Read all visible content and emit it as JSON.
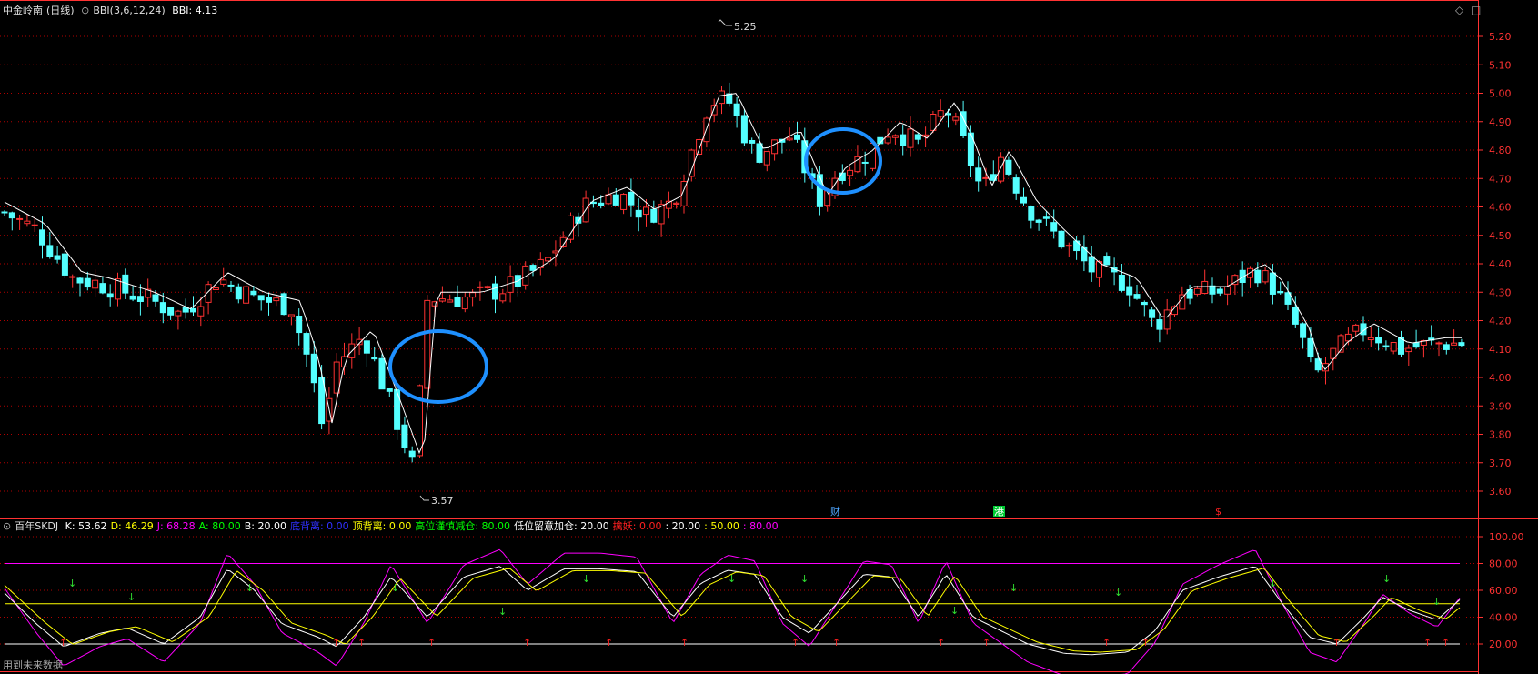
{
  "main": {
    "stock_name": "中金岭南",
    "period": "(日线)",
    "indicator": "BBI(3,6,12,24)",
    "indicator_value": "BBI: 4.13",
    "high_label": "5.25",
    "low_label": "3.57",
    "price_ticks": [
      "5.20",
      "5.10",
      "5.00",
      "4.90",
      "4.80",
      "4.70",
      "4.60",
      "4.50",
      "4.40",
      "4.30",
      "4.20",
      "4.10",
      "4.00",
      "3.90",
      "3.80",
      "3.70",
      "3.60"
    ],
    "event_marks": [
      {
        "text": "财",
        "color": "#4ea6ff"
      },
      {
        "text": "港",
        "color": "#30e030"
      },
      {
        "text": "$",
        "color": "#ff2020"
      }
    ]
  },
  "sub": {
    "name": "百年SKDJ",
    "fields": [
      {
        "label": "K: 53.62",
        "color": "#ffffff"
      },
      {
        "label": "D: 46.29",
        "color": "#ffff00"
      },
      {
        "label": "J: 68.28",
        "color": "#ff00ff"
      },
      {
        "label": "A: 80.00",
        "color": "#00ff00"
      },
      {
        "label": "B: 20.00",
        "color": "#ffffff"
      },
      {
        "label": "底背离: 0.00",
        "color": "#3030ff"
      },
      {
        "label": "顶背离: 0.00",
        "color": "#ffff00"
      },
      {
        "label": "高位谨慎减仓: 80.00",
        "color": "#00ff00"
      },
      {
        "label": "低位留意加仓: 20.00",
        "color": "#ffffff"
      },
      {
        "label": "擒妖: 0.00",
        "color": "#ff2020"
      },
      {
        "label": ": 20.00",
        "color": "#ffffff"
      },
      {
        "label": ": 50.00",
        "color": "#ffff00"
      },
      {
        "label": ": 80.00",
        "color": "#ff00ff"
      }
    ],
    "ticks": [
      "100.00",
      "80.00",
      "60.00",
      "40.00",
      "20.00"
    ]
  },
  "footer_note": "用到未来数据",
  "colors": {
    "up": "#ff3232",
    "down": "#54ffff",
    "grid": "#b00000",
    "axis": "#ff3232",
    "bbi": "#ffffff",
    "circle": "#1e90ff",
    "k": "#ffffff",
    "d": "#ffff00",
    "j": "#ff00ff",
    "line80": "#ff00ff",
    "line50": "#ffff00",
    "line20": "#ffffff"
  },
  "icons": {
    "sub_toggle": "circle-chevron-icon",
    "float": "diamond-icon",
    "close": "square-icon"
  },
  "chart_data": {
    "type": "candlestick",
    "price_range": [
      3.55,
      5.28
    ],
    "high": 5.25,
    "low": 3.57,
    "bbi_last": 4.13,
    "subchart": {
      "type": "line",
      "ylim": [
        0,
        110
      ],
      "K": 53.62,
      "D": 46.29,
      "J": 68.28,
      "levels": [
        20,
        50,
        80
      ]
    }
  }
}
